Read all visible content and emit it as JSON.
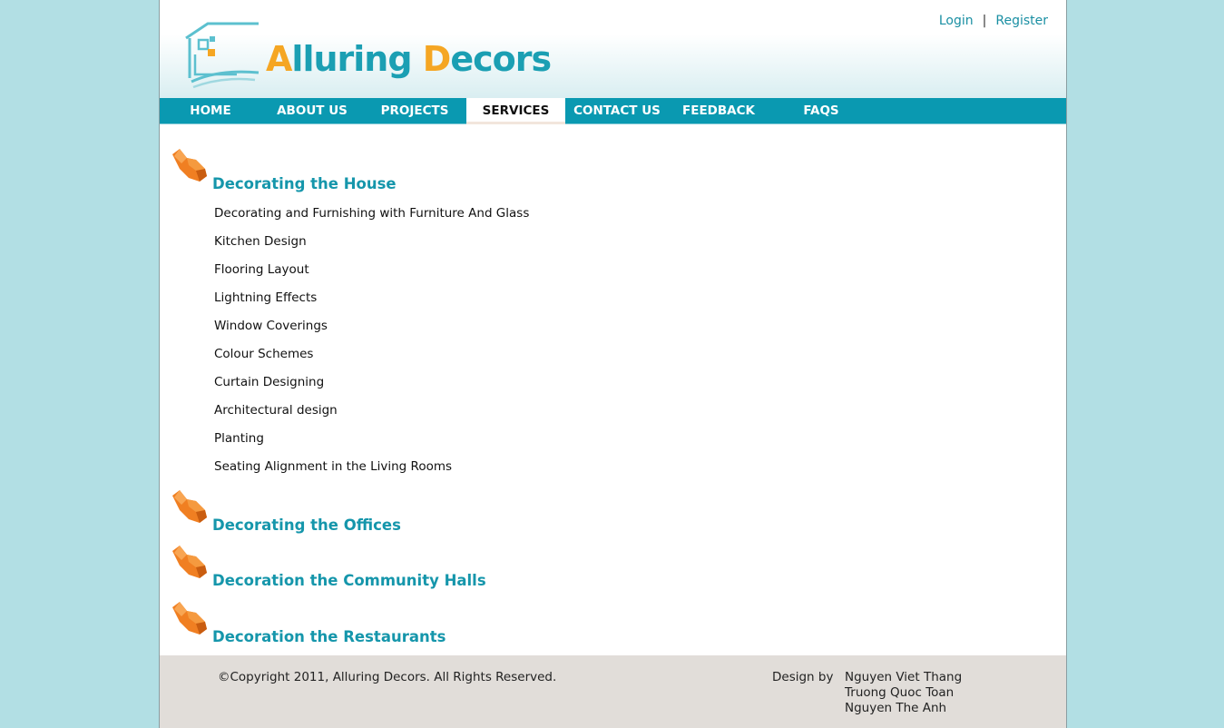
{
  "header": {
    "logo_main": "lluring ",
    "logo_first": "A",
    "logo_second": "D",
    "logo_rest": "ecors",
    "login": "Login",
    "separator": "|",
    "register": "Register"
  },
  "nav": {
    "home": "HOME",
    "about": "ABOUT US",
    "projects": "PROJECTS",
    "services": "SERVICES",
    "contact": "CONTACT US",
    "feedback": "FEEDBACK",
    "faqs": "FAQS"
  },
  "sections": {
    "house": "Decorating the House",
    "offices": "Decorating the Offices",
    "halls": "Decoration the Community Halls",
    "restaurants": "Decoration the Restaurants"
  },
  "house_items": [
    "Decorating and Furnishing with Furniture And Glass",
    "Kitchen Design",
    "Flooring Layout",
    "Lightning Effects",
    "Window Coverings",
    "Colour Schemes",
    "Curtain Designing",
    "Architectural design",
    "Planting",
    "Seating Alignment in the Living Rooms"
  ],
  "footer": {
    "copyright": "©Copyright 2011, Alluring Decors. All Rights Reserved.",
    "design_by": "Design by",
    "designers": [
      "Nguyen Viet Thang",
      "Truong Quoc Toan",
      "Nguyen The Anh"
    ]
  },
  "colors": {
    "background": "#b2dfe4",
    "nav": "#0a99b1",
    "accent_teal": "#1596ab",
    "accent_orange": "#f5a623",
    "footer": "#e1ddd9"
  }
}
